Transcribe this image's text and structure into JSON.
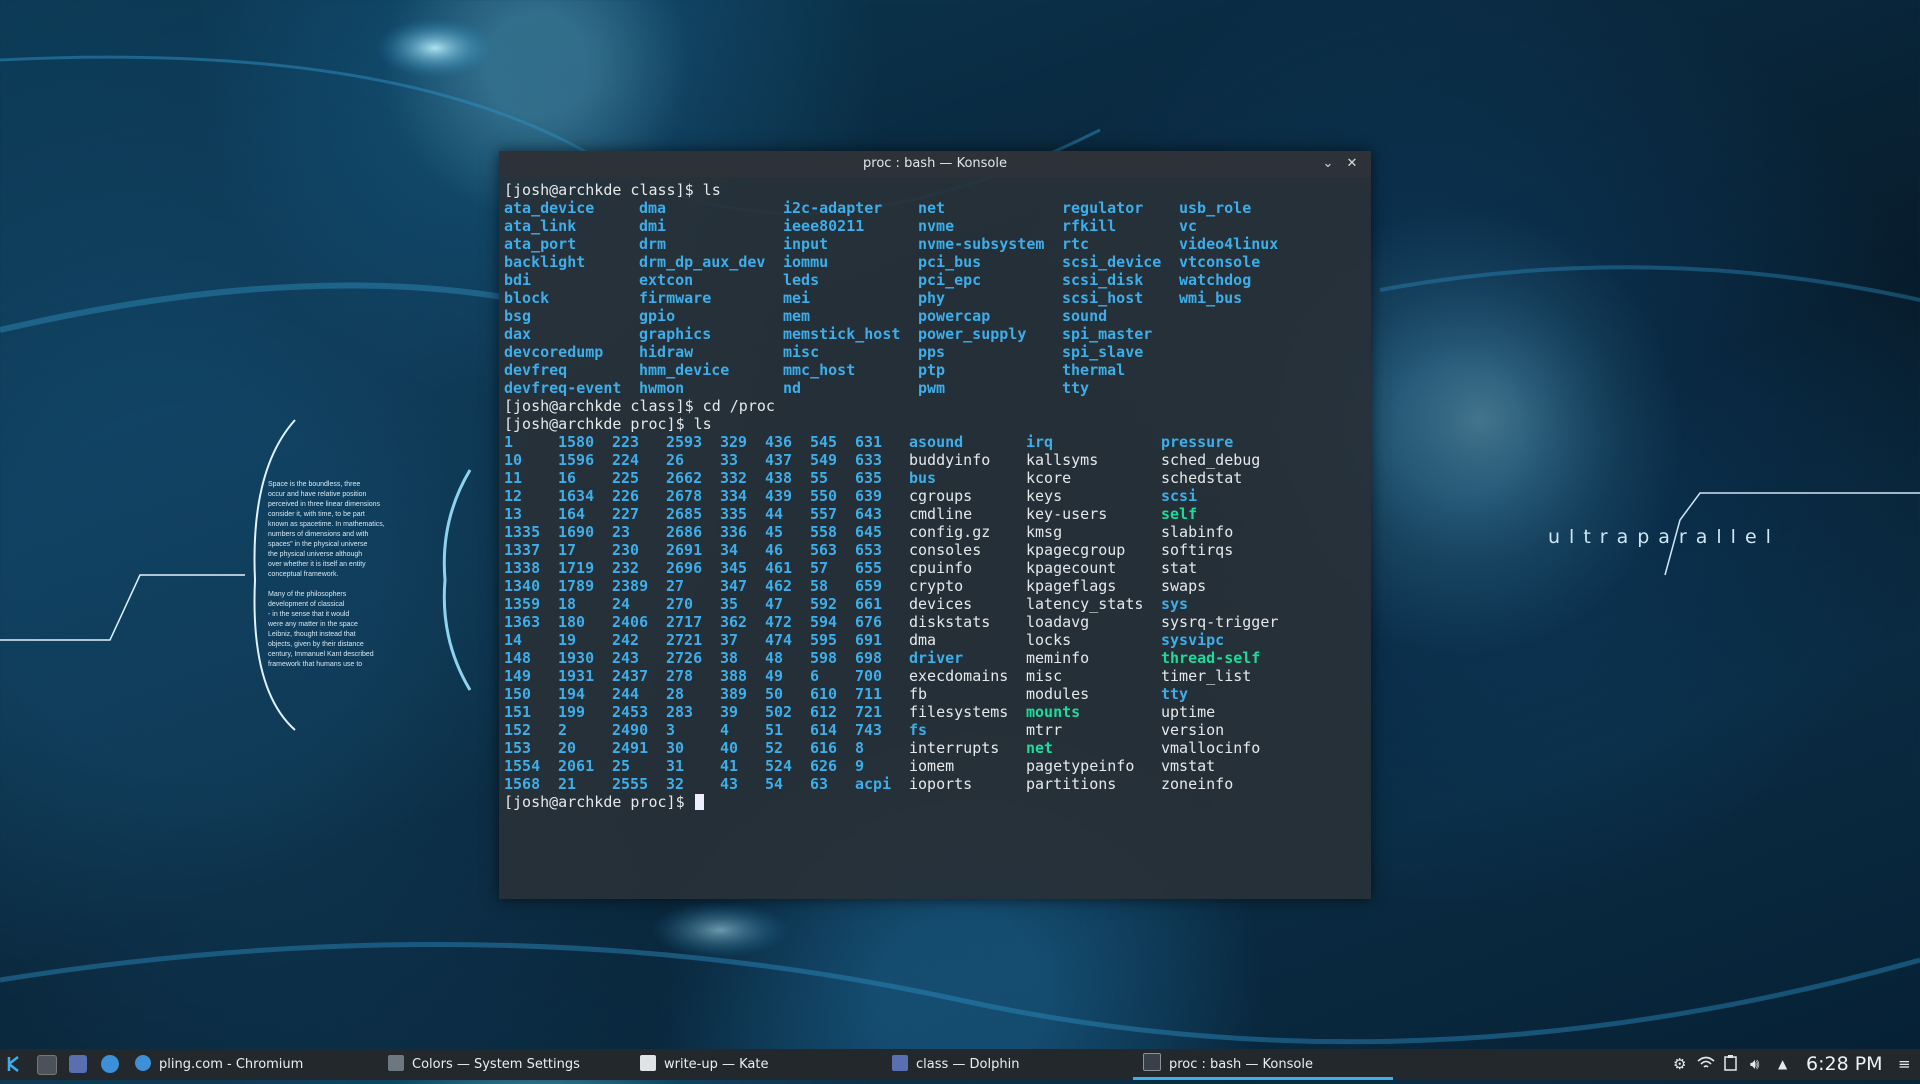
{
  "wallpaper": {
    "brand_text": "ultraparallel",
    "quote_lines": [
      "Space is the boundless, three",
      "occur and have relative position",
      "perceived in three linear dimensions",
      "consider it, with time, to be part",
      "known as spacetime. In mathematics,",
      "numbers of dimensions and with",
      "spaces\" in the physical universe",
      "the physical universe although",
      "over whether it is itself an entity",
      "conceptual framework.",
      "",
      "Many of the philosophers",
      "development of classical",
      "- in the sense that it would",
      "were any matter in the space",
      "Leibniz, thought instead that",
      "objects, given by their distance",
      "century, Immanuel Kant described",
      "framework that humans use to"
    ]
  },
  "window": {
    "title": "proc : bash — Konsole",
    "minimize_glyph": "⌄",
    "close_glyph": "✕"
  },
  "terminal": {
    "prompt_class": "[josh@archkde class]$ ls",
    "class_listing": [
      [
        "ata_device",
        "dma",
        "i2c-adapter",
        "net",
        "regulator",
        "usb_role"
      ],
      [
        "ata_link",
        "dmi",
        "ieee80211",
        "nvme",
        "rfkill",
        "vc"
      ],
      [
        "ata_port",
        "drm",
        "input",
        "nvme-subsystem",
        "rtc",
        "video4linux"
      ],
      [
        "backlight",
        "drm_dp_aux_dev",
        "iommu",
        "pci_bus",
        "scsi_device",
        "vtconsole"
      ],
      [
        "bdi",
        "extcon",
        "leds",
        "pci_epc",
        "scsi_disk",
        "watchdog"
      ],
      [
        "block",
        "firmware",
        "mei",
        "phy",
        "scsi_host",
        "wmi_bus"
      ],
      [
        "bsg",
        "gpio",
        "mem",
        "powercap",
        "sound",
        ""
      ],
      [
        "dax",
        "graphics",
        "memstick_host",
        "power_supply",
        "spi_master",
        ""
      ],
      [
        "devcoredump",
        "hidraw",
        "misc",
        "pps",
        "spi_slave",
        ""
      ],
      [
        "devfreq",
        "hmm_device",
        "mmc_host",
        "ptp",
        "thermal",
        ""
      ],
      [
        "devfreq-event",
        "hwmon",
        "nd",
        "pwm",
        "tty",
        ""
      ]
    ],
    "cd_line": "[josh@archkde class]$ cd /proc",
    "prompt_proc": "[josh@archkde proc]$ ls",
    "proc_listing": [
      [
        "1",
        "1580",
        "223",
        "2593",
        "329",
        "436",
        "545",
        "631",
        "asound",
        "irq",
        "pressure"
      ],
      [
        "10",
        "1596",
        "224",
        "26",
        "33",
        "437",
        "549",
        "633",
        "buddyinfo",
        "kallsyms",
        "sched_debug"
      ],
      [
        "11",
        "16",
        "225",
        "2662",
        "332",
        "438",
        "55",
        "635",
        "bus",
        "kcore",
        "schedstat"
      ],
      [
        "12",
        "1634",
        "226",
        "2678",
        "334",
        "439",
        "550",
        "639",
        "cgroups",
        "keys",
        "scsi"
      ],
      [
        "13",
        "164",
        "227",
        "2685",
        "335",
        "44",
        "557",
        "643",
        "cmdline",
        "key-users",
        "self"
      ],
      [
        "1335",
        "1690",
        "23",
        "2686",
        "336",
        "45",
        "558",
        "645",
        "config.gz",
        "kmsg",
        "slabinfo"
      ],
      [
        "1337",
        "17",
        "230",
        "2691",
        "34",
        "46",
        "563",
        "653",
        "consoles",
        "kpagecgroup",
        "softirqs"
      ],
      [
        "1338",
        "1719",
        "232",
        "2696",
        "345",
        "461",
        "57",
        "655",
        "cpuinfo",
        "kpagecount",
        "stat"
      ],
      [
        "1340",
        "1789",
        "2389",
        "27",
        "347",
        "462",
        "58",
        "659",
        "crypto",
        "kpageflags",
        "swaps"
      ],
      [
        "1359",
        "18",
        "24",
        "270",
        "35",
        "47",
        "592",
        "661",
        "devices",
        "latency_stats",
        "sys"
      ],
      [
        "1363",
        "180",
        "2406",
        "2717",
        "362",
        "472",
        "594",
        "676",
        "diskstats",
        "loadavg",
        "sysrq-trigger"
      ],
      [
        "14",
        "19",
        "242",
        "2721",
        "37",
        "474",
        "595",
        "691",
        "dma",
        "locks",
        "sysvipc"
      ],
      [
        "148",
        "1930",
        "243",
        "2726",
        "38",
        "48",
        "598",
        "698",
        "driver",
        "meminfo",
        "thread-self"
      ],
      [
        "149",
        "1931",
        "2437",
        "278",
        "388",
        "49",
        "6",
        "700",
        "execdomains",
        "misc",
        "timer_list"
      ],
      [
        "150",
        "194",
        "244",
        "28",
        "389",
        "50",
        "610",
        "711",
        "fb",
        "modules",
        "tty"
      ],
      [
        "151",
        "199",
        "2453",
        "283",
        "39",
        "502",
        "612",
        "721",
        "filesystems",
        "mounts",
        "uptime"
      ],
      [
        "152",
        "2",
        "2490",
        "3",
        "4",
        "51",
        "614",
        "743",
        "fs",
        "mtrr",
        "version"
      ],
      [
        "153",
        "20",
        "2491",
        "30",
        "40",
        "52",
        "616",
        "8",
        "interrupts",
        "net",
        "vmallocinfo"
      ],
      [
        "1554",
        "2061",
        "25",
        "31",
        "41",
        "524",
        "626",
        "9",
        "iomem",
        "pagetypeinfo",
        "vmstat"
      ],
      [
        "1568",
        "21",
        "2555",
        "32",
        "43",
        "54",
        "63",
        "acpi",
        "ioports",
        "partitions",
        "zoneinfo"
      ]
    ],
    "proc_dirs": [
      "asound",
      "irq",
      "pressure",
      "bus",
      "scsi",
      "sys",
      "sysvipc",
      "driver",
      "tty",
      "fs",
      "acpi"
    ],
    "proc_links": [
      "self",
      "thread-self",
      "mounts",
      "net"
    ],
    "final_prompt": "[josh@archkde proc]$ "
  },
  "taskbar": {
    "tasks": [
      {
        "label": "pling.com - Chromium",
        "icon": "chromium-icon"
      },
      {
        "label": "Colors — System Settings",
        "icon": "system-settings-icon"
      },
      {
        "label": "write-up — Kate",
        "icon": "kate-icon"
      },
      {
        "label": "class — Dolphin",
        "icon": "dolphin-icon"
      },
      {
        "label": "proc : bash — Konsole",
        "icon": "konsole-icon"
      }
    ],
    "clock": "6:28 PM"
  },
  "colors": {
    "accent": "#3daee9",
    "symlink": "#1cdc9a",
    "taskbar": "#23282d"
  }
}
